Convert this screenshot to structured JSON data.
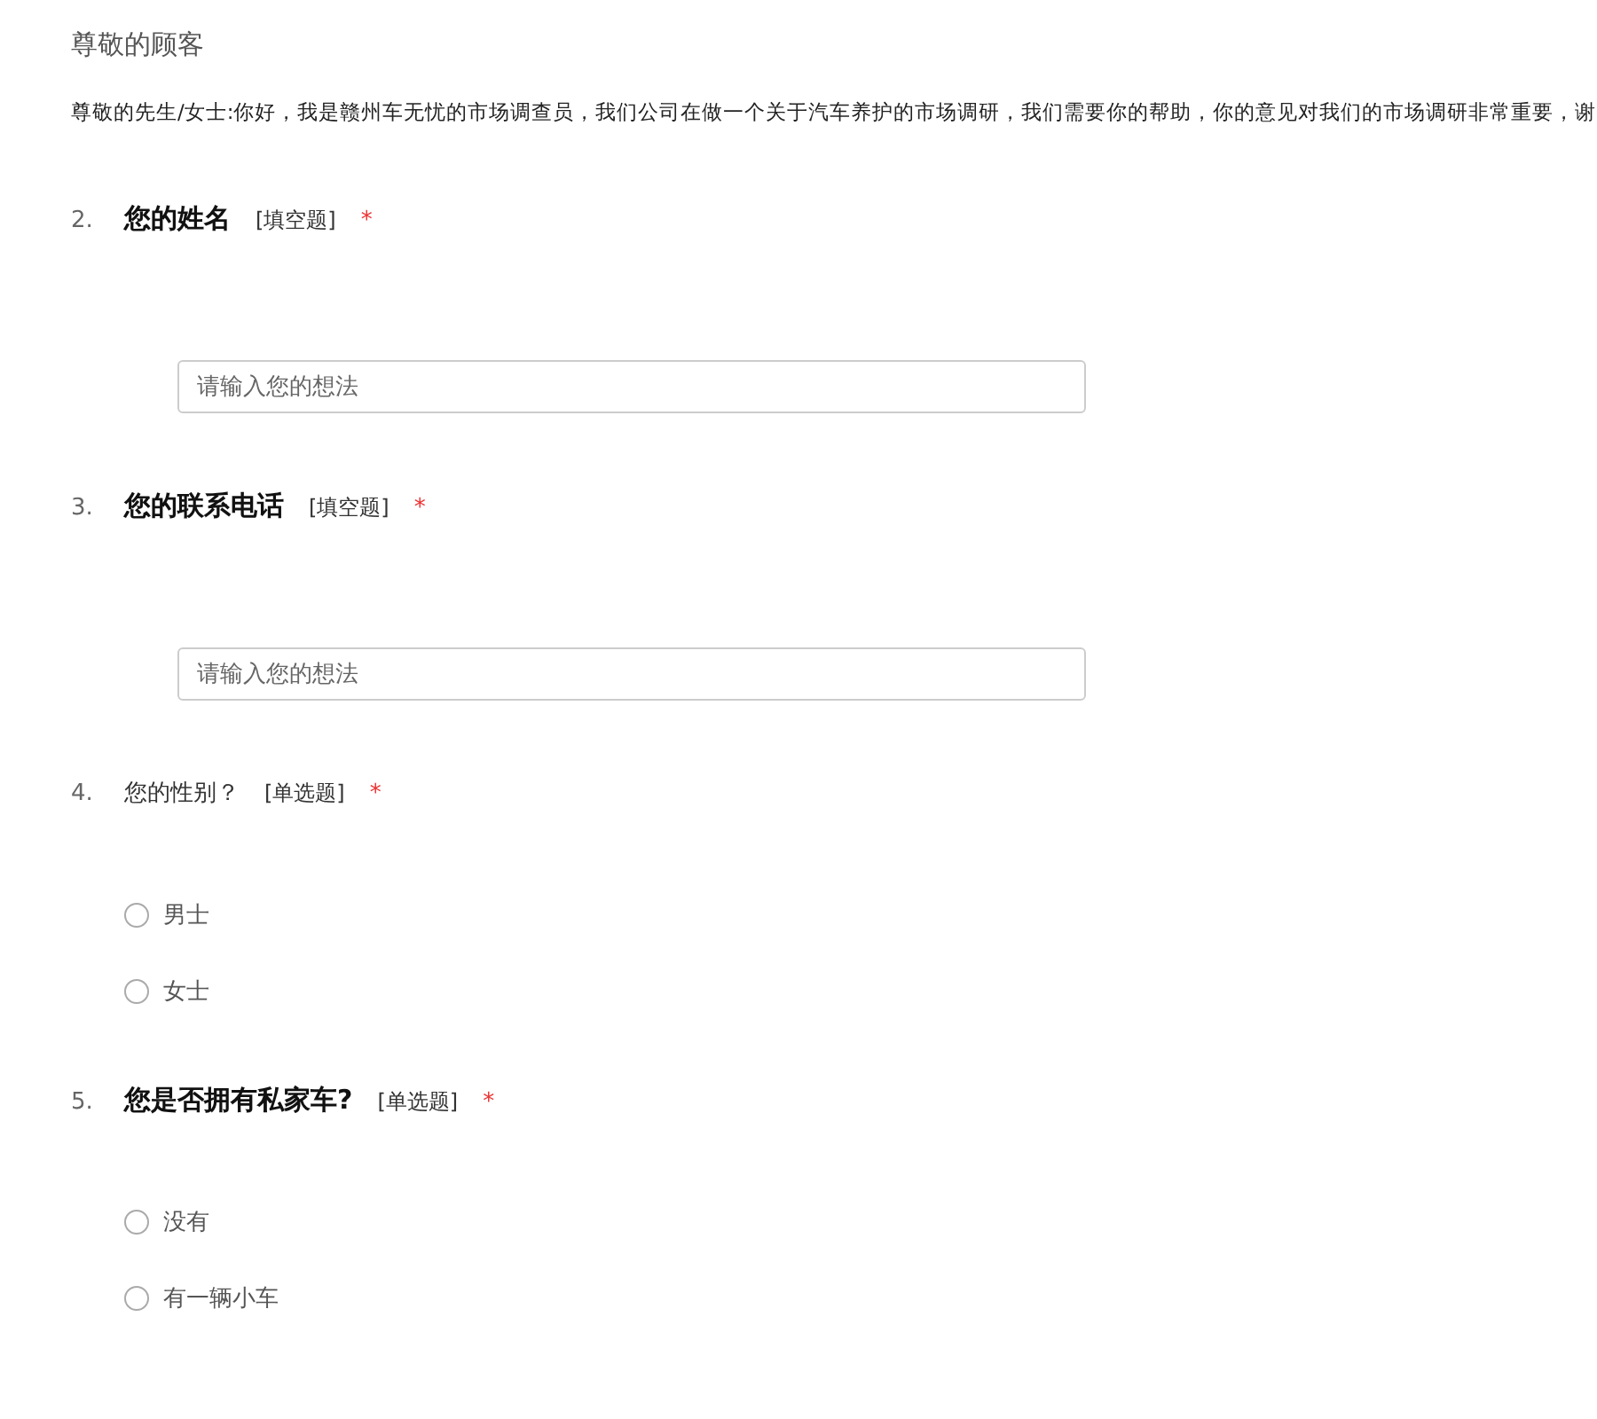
{
  "title": "尊敬的顾客",
  "intro": "尊敬的先生/女士:你好，我是赣州车无忧的市场调查员，我们公司在做一个关于汽车养护的市场调研，我们需要你的帮助，你的意见对我们的市场调研非常重要，谢",
  "questions": [
    {
      "number": "2.",
      "title": "您的姓名",
      "bold": true,
      "type_label": "[填空题]",
      "required_mark": "*",
      "kind": "text",
      "placeholder": "请输入您的想法"
    },
    {
      "number": "3.",
      "title": "您的联系电话",
      "bold": true,
      "type_label": "[填空题]",
      "required_mark": "*",
      "kind": "text",
      "placeholder": "请输入您的想法"
    },
    {
      "number": "4.",
      "title": "您的性别？",
      "bold": false,
      "type_label": "[单选题]",
      "required_mark": "*",
      "kind": "radio",
      "options": [
        {
          "label": "男士",
          "selected": false
        },
        {
          "label": "女士",
          "selected": false
        }
      ]
    },
    {
      "number": "5.",
      "title": "您是否拥有私家车?",
      "bold": true,
      "type_label": "[单选题]",
      "required_mark": "*",
      "kind": "radio",
      "options": [
        {
          "label": "没有",
          "selected": false
        },
        {
          "label": "有一辆小车",
          "selected": false
        }
      ]
    }
  ]
}
